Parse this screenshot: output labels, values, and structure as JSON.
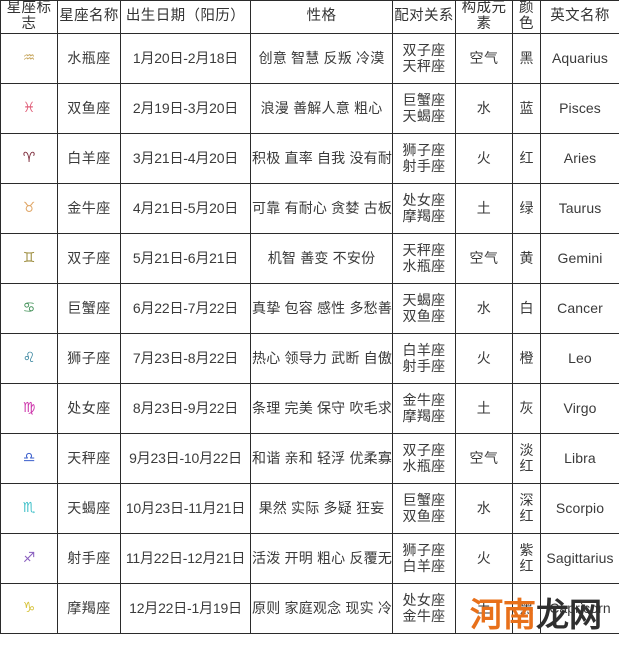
{
  "table": {
    "headers": [
      "星座标志",
      "星座名称",
      "出生日期（阳历）",
      "性格",
      "配对关系",
      "构成元素",
      "颜色",
      "英文名称"
    ],
    "rows": [
      {
        "symbol": "♒",
        "symbol_name": "aquarius-symbol",
        "symbol_color": "#c8a861",
        "name": "水瓶座",
        "date": "1月20日-2月18日",
        "traits": "创意 智慧 反叛 冷漠",
        "match_1": "双子座",
        "match_2": "天秤座",
        "element": "空气",
        "color": "黑",
        "english": "Aquarius"
      },
      {
        "symbol": "♓",
        "symbol_name": "pisces-symbol",
        "symbol_color": "#e0607a",
        "name": "双鱼座",
        "date": "2月19日-3月20日",
        "traits": "浪漫 善解人意 粗心",
        "match_1": "巨蟹座",
        "match_2": "天蝎座",
        "element": "水",
        "color": "蓝",
        "english": "Pisces"
      },
      {
        "symbol": "♈",
        "symbol_name": "aries-symbol",
        "symbol_color": "#7a2838",
        "name": "白羊座",
        "date": "3月21日-4月20日",
        "traits": "积极 直率 自我 没有耐性",
        "match_1": "狮子座",
        "match_2": "射手座",
        "element": "火",
        "color": "红",
        "english": "Aries"
      },
      {
        "symbol": "♉",
        "symbol_name": "taurus-symbol",
        "symbol_color": "#e0a86a",
        "name": "金牛座",
        "date": "4月21日-5月20日",
        "traits": "可靠 有耐心 贪婪 古板",
        "match_1": "处女座",
        "match_2": "摩羯座",
        "element": "土",
        "color": "绿",
        "english": "Taurus"
      },
      {
        "symbol": "♊",
        "symbol_name": "gemini-symbol",
        "symbol_color": "#9a8a3a",
        "name": "双子座",
        "date": "5月21日-6月21日",
        "traits": "机智 善变 不安份",
        "match_1": "天秤座",
        "match_2": "水瓶座",
        "element": "空气",
        "color": "黄",
        "english": "Gemini"
      },
      {
        "symbol": "♋",
        "symbol_name": "cancer-symbol",
        "symbol_color": "#3f8f55",
        "name": "巨蟹座",
        "date": "6月22日-7月22日",
        "traits": "真挚 包容 感性 多愁善感",
        "match_1": "天蝎座",
        "match_2": "双鱼座",
        "element": "水",
        "color": "白",
        "english": "Cancer"
      },
      {
        "symbol": "♌",
        "symbol_name": "leo-symbol",
        "symbol_color": "#2f7f9a",
        "name": "狮子座",
        "date": "7月23日-8月22日",
        "traits": "热心 领导力 武断 自傲",
        "match_1": "白羊座",
        "match_2": "射手座",
        "element": "火",
        "color": "橙",
        "english": "Leo"
      },
      {
        "symbol": "♍",
        "symbol_name": "virgo-symbol",
        "symbol_color": "#cc33aa",
        "name": "处女座",
        "date": "8月23日-9月22日",
        "traits": "条理 完美 保守 吹毛求疵",
        "match_1": "金牛座",
        "match_2": "摩羯座",
        "element": "土",
        "color": "灰",
        "english": "Virgo"
      },
      {
        "symbol": "♎",
        "symbol_name": "libra-symbol",
        "symbol_color": "#3b5fcc",
        "name": "天秤座",
        "date": "9月23日-10月22日",
        "traits": "和谐 亲和 轻浮 优柔寡断",
        "match_1": "双子座",
        "match_2": "水瓶座",
        "element": "空气",
        "color": "淡红",
        "english": "Libra"
      },
      {
        "symbol": "♏",
        "symbol_name": "scorpio-symbol",
        "symbol_color": "#3fc0c8",
        "name": "天蝎座",
        "date": "10月23日-11月21日",
        "traits": "果然 实际 多疑 狂妄",
        "match_1": "巨蟹座",
        "match_2": "双鱼座",
        "element": "水",
        "color": "深红",
        "english": "Scorpio"
      },
      {
        "symbol": "♐",
        "symbol_name": "sagittarius-symbol",
        "symbol_color": "#8a5fbf",
        "name": "射手座",
        "date": "11月22日-12月21日",
        "traits": "活泼 开明 粗心 反覆无常",
        "match_1": "狮子座",
        "match_2": "白羊座",
        "element": "火",
        "color": "紫红",
        "english": "Sagittarius"
      },
      {
        "symbol": "♑",
        "symbol_name": "capricorn-symbol",
        "symbol_color": "#d6c23a",
        "name": "摩羯座",
        "date": "12月22日-1月19日",
        "traits": "原则 家庭观念 现实 冷漠",
        "match_1": "处女座",
        "match_2": "金牛座",
        "element": "土",
        "color": "黑",
        "english": "Capricorn"
      }
    ]
  },
  "watermark": {
    "part_a": "河南",
    "part_b": "龙网"
  }
}
